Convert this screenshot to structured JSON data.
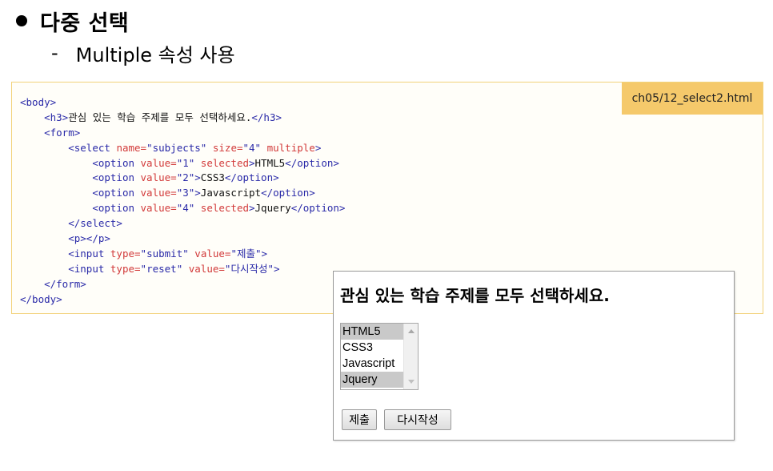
{
  "heading": "다중 선택",
  "subheading": {
    "dash": "-",
    "text": "Multiple 속성 사용"
  },
  "file_tag": "ch05/12_select2.html",
  "code": {
    "l1_body_open": "<body>",
    "l2_h3_open": "<h3>",
    "l2_text": "관심 있는 학습 주제를 모두 선택하세요.",
    "l2_h3_close": "</h3>",
    "l3_form_open": "<form>",
    "l4_select_open": "<select ",
    "l4_attr_name": "name=",
    "l4_val_name": "\"subjects\"",
    "l4_attr_size": " size=",
    "l4_val_size": "\"4\"",
    "l4_attr_multiple": " multiple",
    "l4_end": ">",
    "l5_option_open": "<option ",
    "l5_attr_value": "value=",
    "l5_val": "\"1\"",
    "l5_attr_selected": " selected",
    "l5_end": ">",
    "l5_text": "HTML5",
    "l5_close": "</option>",
    "l6_option_open": "<option ",
    "l6_attr_value": "value=",
    "l6_val": "\"2\"",
    "l6_end": ">",
    "l6_text": "CSS3",
    "l6_close": "</option>",
    "l7_option_open": "<option ",
    "l7_attr_value": "value=",
    "l7_val": "\"3\"",
    "l7_end": ">",
    "l7_text": "Javascript",
    "l7_close": "</option>",
    "l8_option_open": "<option ",
    "l8_attr_value": "value=",
    "l8_val": "\"4\"",
    "l8_attr_selected": " selected",
    "l8_end": ">",
    "l8_text": "Jquery",
    "l8_close": "</option>",
    "l9_select_close": "</select>",
    "l10_p": "<p></p>",
    "l11_input_open": "<input ",
    "l11_attr_type": "type=",
    "l11_val_type": "\"submit\"",
    "l11_attr_value": " value=",
    "l11_val_value": "\"제출\"",
    "l11_end": ">",
    "l12_input_open": "<input ",
    "l12_attr_type": "type=",
    "l12_val_type": "\"reset\"",
    "l12_attr_value": " value=",
    "l12_val_value": "\"다시작성\"",
    "l12_end": ">",
    "l13_form_close": "</form>",
    "l14_body_close": "</body>"
  },
  "result": {
    "title": "관심 있는 학습 주제를 모두 선택하세요.",
    "options": [
      {
        "label": "HTML5",
        "selected": true
      },
      {
        "label": "CSS3",
        "selected": false
      },
      {
        "label": "Javascript",
        "selected": false
      },
      {
        "label": "Jquery",
        "selected": true
      }
    ],
    "submit_label": "제출",
    "reset_label": "다시작성"
  },
  "colors": {
    "file_tag_bg": "#f5c96b",
    "code_border": "#f2d27a",
    "tag": "#2a2aa8",
    "attr": "#d23a3a",
    "selected_option_bg": "#c9c9c9"
  }
}
